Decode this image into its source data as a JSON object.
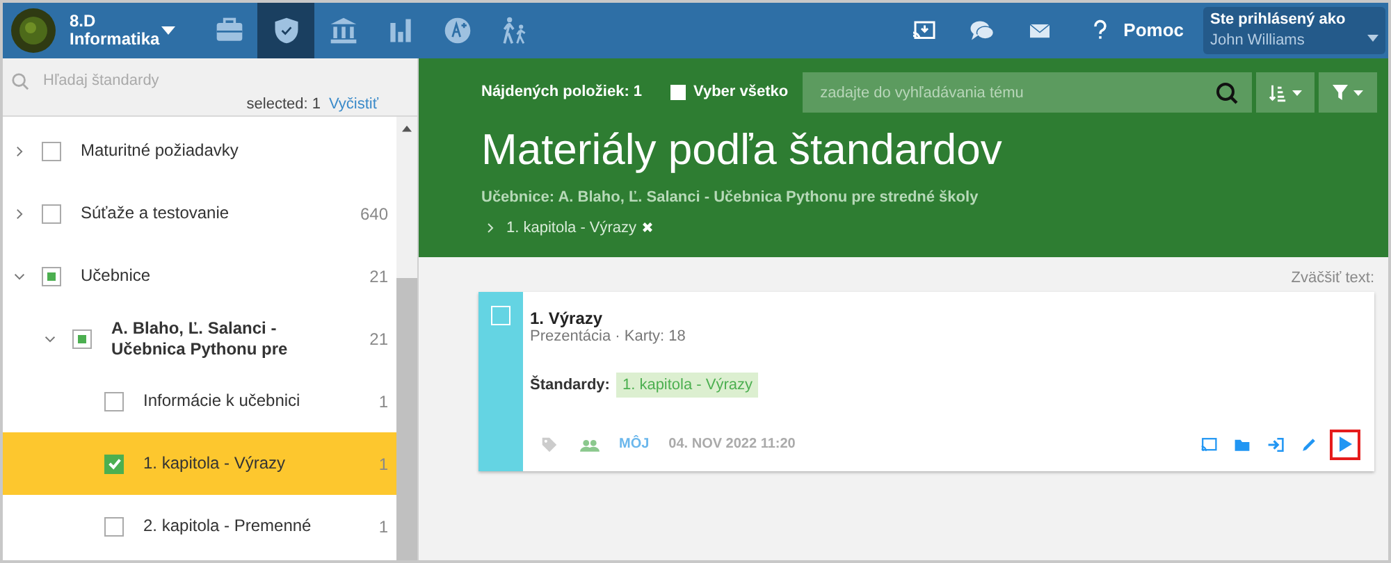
{
  "header": {
    "class_name": "8.D\nInformatika",
    "nav": [
      {
        "selected": false
      },
      {
        "selected": true
      },
      {
        "selected": false
      },
      {
        "selected": false
      },
      {
        "selected": false
      },
      {
        "selected": false
      }
    ],
    "help": "Pomoc",
    "user_label": "Ste prihlásený ako",
    "user": "John Williams"
  },
  "sidebar": {
    "search_placeholder": "Hľadaj štandardy",
    "selected_text": "selected: 1",
    "clear": "Vyčistiť",
    "tree": [
      {
        "label": "Maturitné požiadavky",
        "expanded": false,
        "checked": false,
        "partial": false,
        "selected": false
      },
      {
        "label": "Súťaže a testovanie",
        "count": "640",
        "expanded": false,
        "checked": false,
        "partial": false,
        "selected": false
      },
      {
        "label": "Učebnice",
        "count": "21",
        "expanded": true,
        "checked": false,
        "partial": true,
        "selected": false,
        "children": [
          {
            "label": "A. Blaho, Ľ. Salanci -\nUčebnica Pythonu pre",
            "count": "21",
            "expanded": true,
            "checked": false,
            "partial": true,
            "selected": false,
            "children": [
              {
                "label": "Informácie k učebnici",
                "count": "1",
                "checked": false,
                "partial": false,
                "selected": false
              },
              {
                "label": "1. kapitola - Výrazy",
                "count": "1",
                "checked": true,
                "partial": false,
                "selected": true
              },
              {
                "label": "2. kapitola - Premenné",
                "count": "1",
                "checked": false,
                "partial": false,
                "selected": false
              }
            ]
          }
        ]
      }
    ]
  },
  "toolbar": {
    "found": "Nájdených položiek: 1",
    "select_all": "Vyber všetko",
    "select_all_checked": false,
    "search_placeholder": "zadajte do vyhľadávania tému"
  },
  "title": "Materiály podľa štandardov",
  "filter_path": "Učebnice: A. Blaho, Ľ. Salanci - Učebnica Pythonu pre stredné školy",
  "filter_tag": "1. kapitola - Výrazy",
  "zoom_text": "Zväčšiť text:",
  "card": {
    "title": "1. Výrazy",
    "meta": "Prezentácia · Karty: 18",
    "checked": false,
    "standards_label": "Štandardy:",
    "standard": "1. kapitola - Výrazy",
    "owner": "MÔJ",
    "date": "04. NOV 2022 11:20"
  }
}
